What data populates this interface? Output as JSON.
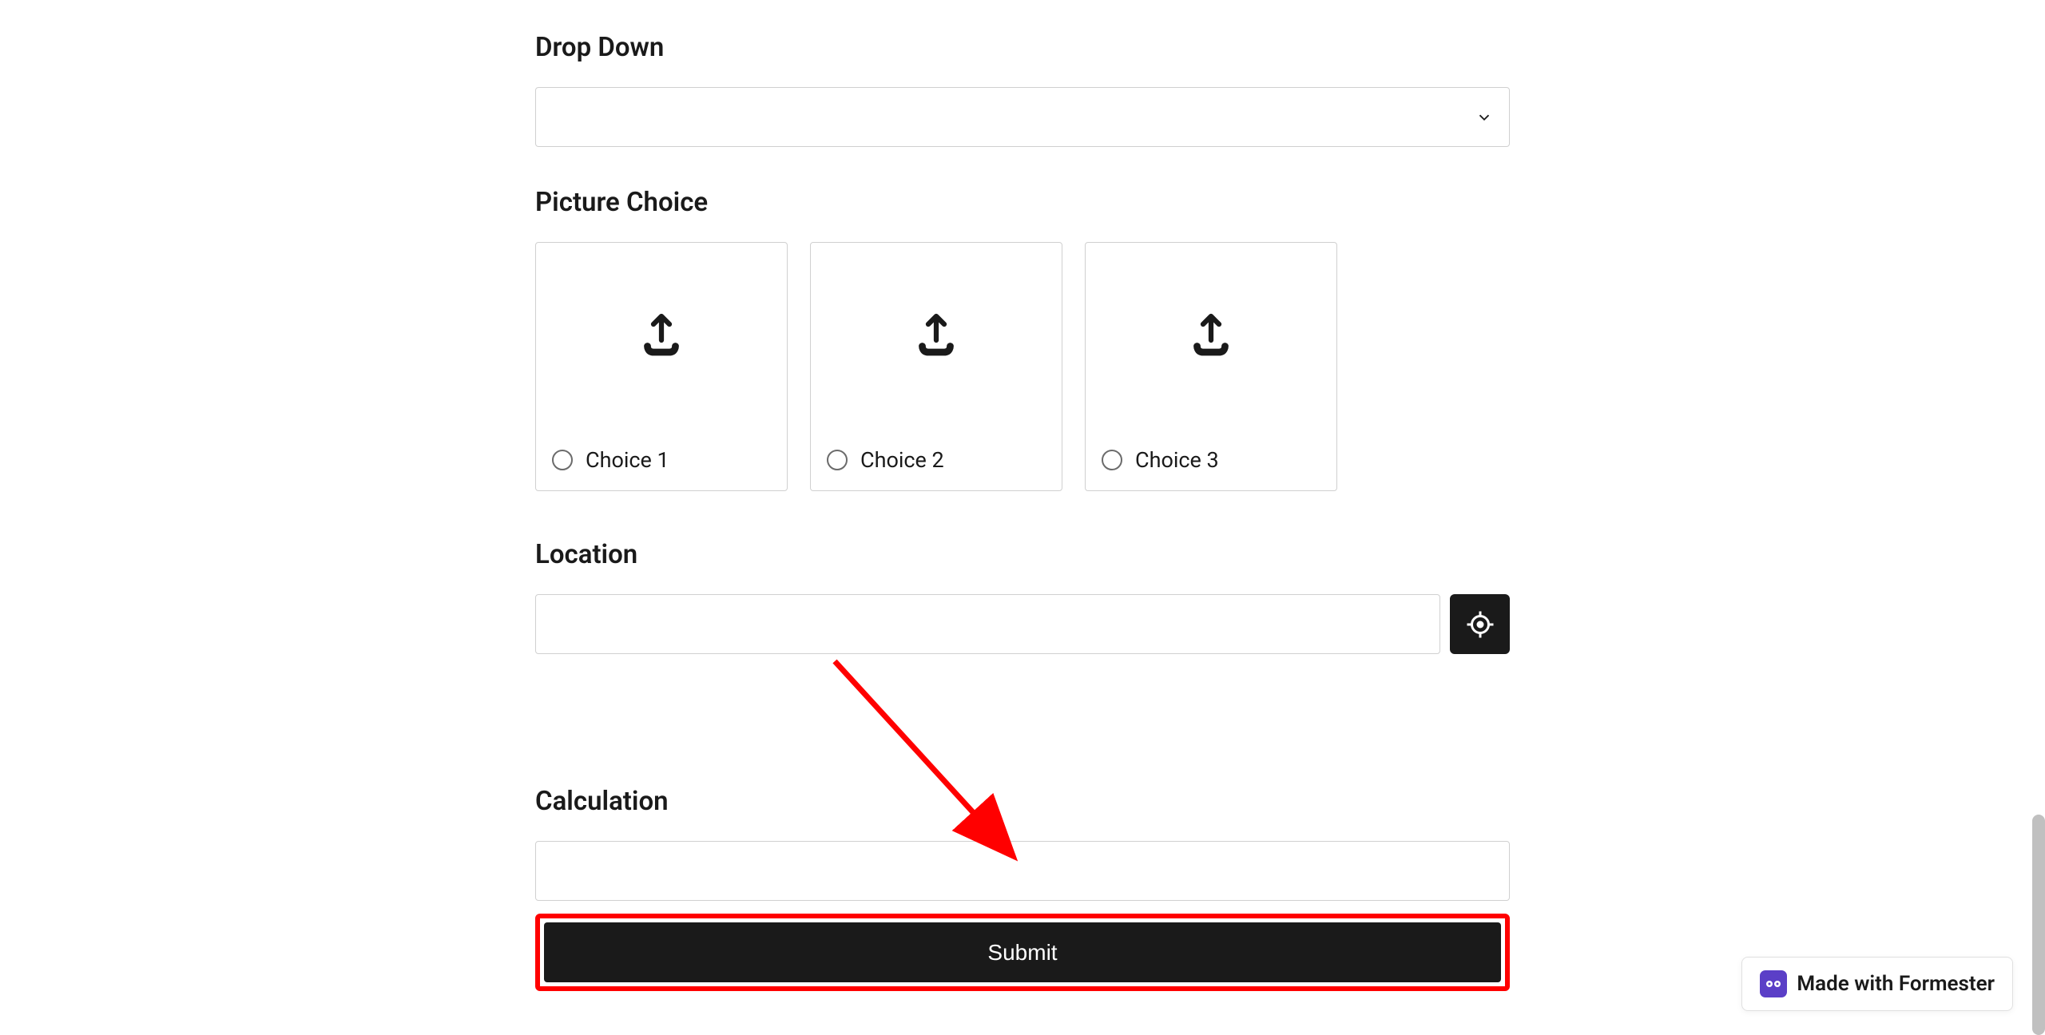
{
  "dropdown": {
    "label": "Drop Down",
    "value": ""
  },
  "pictureChoice": {
    "label": "Picture Choice",
    "options": [
      {
        "label": "Choice 1"
      },
      {
        "label": "Choice 2"
      },
      {
        "label": "Choice 3"
      }
    ]
  },
  "location": {
    "label": "Location",
    "value": ""
  },
  "calculation": {
    "label": "Calculation",
    "value": ""
  },
  "submit": {
    "label": "Submit"
  },
  "badge": {
    "text": "Made with Formester"
  }
}
